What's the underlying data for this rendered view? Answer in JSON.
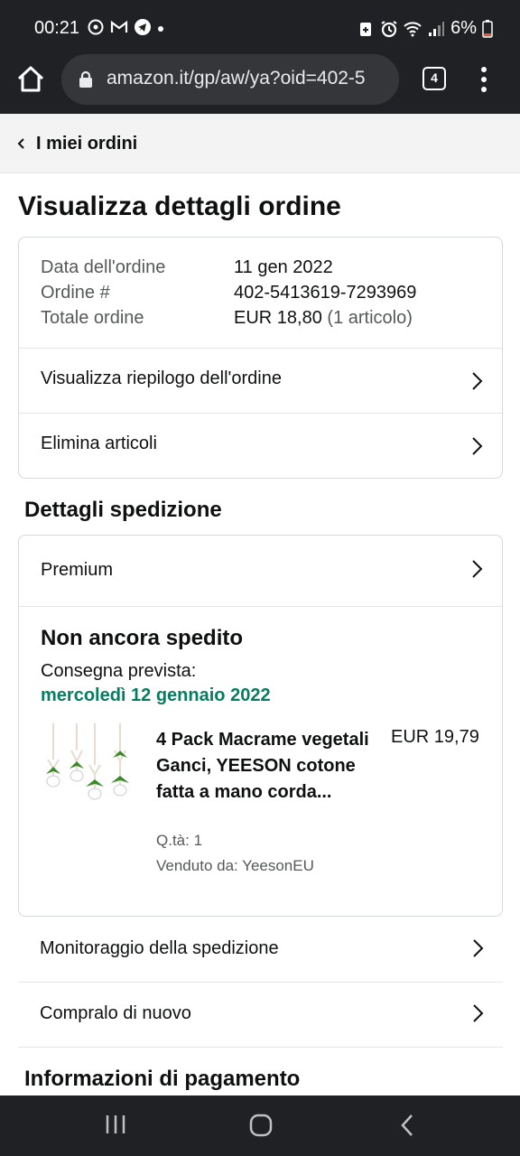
{
  "status_bar": {
    "time": "00:21",
    "battery": "6%",
    "left_icons": [
      "whatsapp-icon",
      "gmail-icon",
      "telegram-icon",
      "dot-icon"
    ],
    "right_icons": [
      "battery-saver-icon",
      "alarm-icon",
      "wifi-icon",
      "signal-icon",
      "battery-icon"
    ]
  },
  "browser": {
    "url": "amazon.it/gp/aw/ya?oid=402-5",
    "tab_count": "4"
  },
  "nav": {
    "back_label": "I miei ordini"
  },
  "page": {
    "title": "Visualizza dettagli ordine"
  },
  "order_summary": {
    "date_label": "Data dell'ordine",
    "date_value": "11 gen 2022",
    "order_num_label": "Ordine #",
    "order_num_value": "402-5413619-7293969",
    "total_label": "Totale ordine",
    "total_value": "EUR 18,80",
    "total_items": "(1 articolo)",
    "view_summary_label": "Visualizza riepilogo dell'ordine",
    "delete_items_label": "Elimina articoli"
  },
  "shipping": {
    "section_title": "Dettagli spedizione",
    "shipping_type": "Premium",
    "status": "Non ancora spedito",
    "delivery_label": "Consegna prevista:",
    "delivery_date": "mercoledì 12 gennaio 2022",
    "item": {
      "title": "4 Pack Macrame vegetali Ganci, YEESON cotone fatta a mano corda...",
      "price": "EUR 19,79",
      "quantity": "Q.tà: 1",
      "seller": "Venduto da: YeesonEU"
    },
    "track_label": "Monitoraggio della spedizione",
    "buy_again_label": "Compralo di nuovo"
  },
  "payment": {
    "section_title": "Informazioni di pagamento"
  },
  "colors": {
    "system_bar": "#202124",
    "url_box": "#35363a",
    "delivery_green": "#067d62",
    "border": "#d5d9d9"
  }
}
